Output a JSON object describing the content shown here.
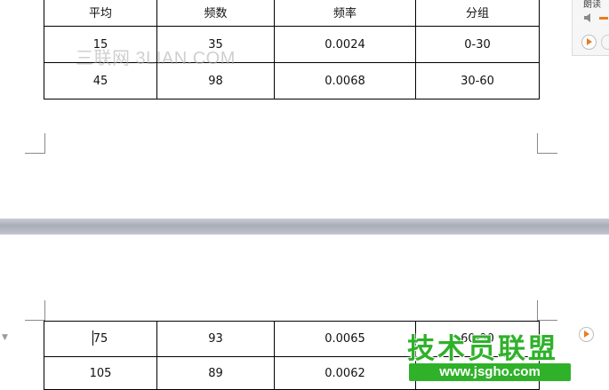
{
  "table_top": {
    "header": [
      "平均",
      "频数",
      "频率",
      "分组"
    ],
    "rows": [
      [
        "15",
        "35",
        "0.0024",
        "0-30"
      ],
      [
        "45",
        "98",
        "0.0068",
        "30-60"
      ]
    ]
  },
  "table_bottom": {
    "rows": [
      [
        "75",
        "93",
        "0.0065",
        "60-90"
      ],
      [
        "105",
        "89",
        "0.0062",
        "90-120"
      ]
    ]
  },
  "side_panel": {
    "title": "朗读"
  },
  "watermarks": {
    "top_text": "三联网 3LIAN.COM",
    "logo_text": "技术员联盟",
    "url_text": "www.jsgho.com"
  },
  "icons": {
    "speaker": "speaker-icon",
    "play": "play-icon",
    "collapse": "collapse-arrow-icon"
  },
  "colors": {
    "accent": "#e67e22",
    "watermark_green": "#2fb12a",
    "page_gap": "#b3b7c0"
  }
}
